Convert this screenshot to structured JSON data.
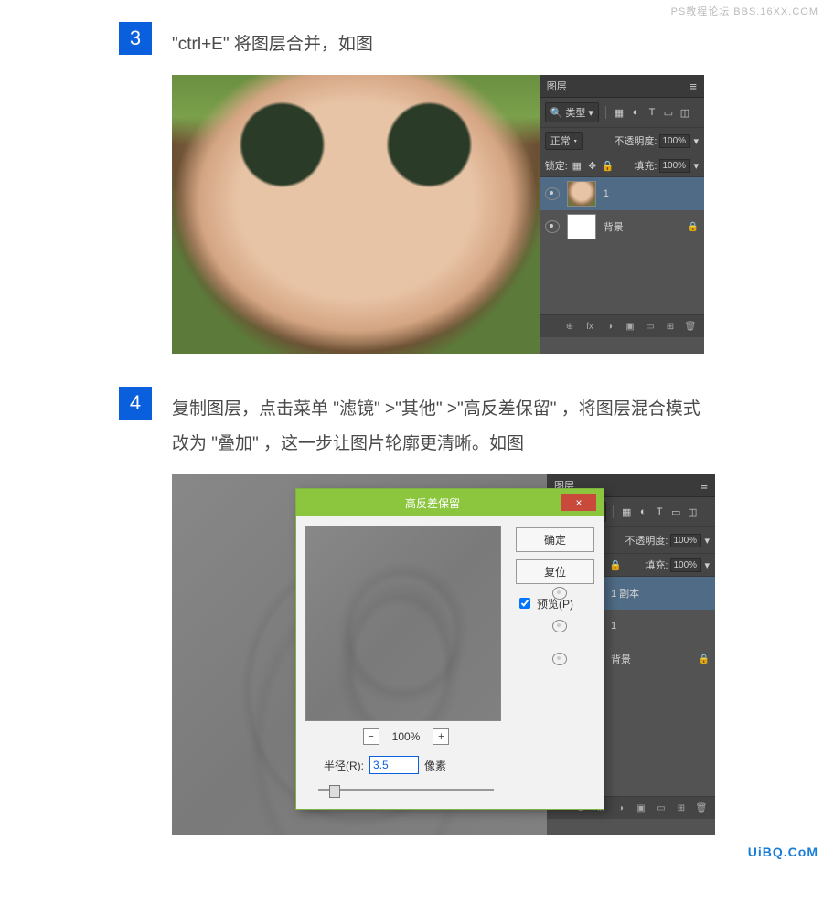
{
  "watermark_top": "PS教程论坛 BBS.16XX.COM",
  "watermark_bottom": "UiBQ.CoM",
  "steps": {
    "s3": {
      "num": "3",
      "text": "\"ctrl+E\" 将图层合并，如图"
    },
    "s4": {
      "num": "4",
      "text": "复制图层，点击菜单 \"滤镜\" >\"其他\" >\"高反差保留\" ，将图层混合模式改为 \"叠加\" ，这一步让图片轮廓更清晰。如图"
    }
  },
  "panel": {
    "title": "图层",
    "filter_label": "类型",
    "blend_mode": "正常",
    "opacity_label": "不透明度:",
    "opacity_val": "100%",
    "lock_label": "锁定:",
    "fill_label": "填充:",
    "fill_val": "100%",
    "icons": {
      "img": "▦",
      "adj": "◐",
      "type": "T",
      "shape": "▭",
      "smart": "◫",
      "search": "🔍",
      "menu": "≡",
      "tri": "▾"
    },
    "layers_a": [
      {
        "name": "1",
        "thumb": "face",
        "active": true,
        "locked": false
      },
      {
        "name": "背景",
        "thumb": "white",
        "active": false,
        "locked": true
      }
    ],
    "layers_b": [
      {
        "name": "1 副本",
        "thumb": "gray",
        "active": true,
        "locked": false
      },
      {
        "name": "1",
        "thumb": "face",
        "active": false,
        "locked": false
      },
      {
        "name": "背景",
        "thumb": "white",
        "active": false,
        "locked": true
      }
    ],
    "footer_icons": [
      "⊕",
      "fx",
      "◑",
      "▣",
      "▭",
      "⊞",
      "🗑"
    ]
  },
  "dialog": {
    "title": "高反差保留",
    "ok": "确定",
    "reset": "复位",
    "preview_label": "预览(P)",
    "zoom": "100%",
    "radius_label": "半径(R):",
    "radius_val": "3.5",
    "radius_unit": "像素",
    "close": "×"
  }
}
